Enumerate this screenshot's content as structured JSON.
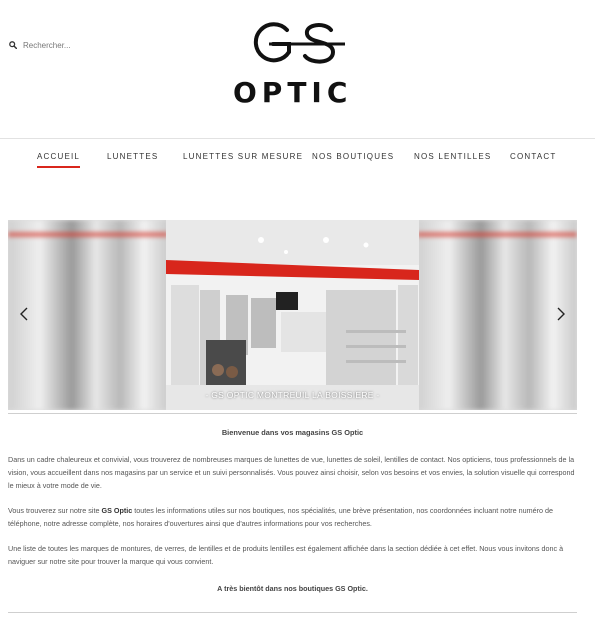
{
  "search": {
    "placeholder": "Rechercher..."
  },
  "logo": {
    "top": "GS",
    "bottom": "OPTIC"
  },
  "nav": {
    "items": [
      {
        "label": "ACCUEIL"
      },
      {
        "label": "LUNETTES"
      },
      {
        "label": "LUNETTES SUR MESURE"
      },
      {
        "label": "NOS BOUTIQUES"
      },
      {
        "label": "NOS LENTILLES"
      },
      {
        "label": "CONTACT"
      }
    ],
    "active_color": "#d9261c"
  },
  "slider": {
    "caption": "- GS OPTIC MONTREUIL LA BOISSIERE -",
    "prev_icon": "chevron-left-icon",
    "next_icon": "chevron-right-icon"
  },
  "content": {
    "heading": "Bienvenue dans vos magasins GS Optic",
    "p1": "Dans un cadre chaleureux et convivial, vous trouverez de nombreuses marques de lunettes de vue, lunettes de soleil, lentilles de contact. Nos opticiens, tous professionnels de la vision, vous accueillent dans nos magasins par un service et un suivi personnalisés. Vous pouvez ainsi choisir, selon vos besoins et vos envies, la solution visuelle qui correspond le mieux à votre mode de vie.",
    "p2_pre": "Vous trouverez sur notre site ",
    "p2_brand": "GS Optic",
    "p2_post": " toutes les informations utiles sur nos boutiques, nos spécialités, une brève présentation, nos coordonnées incluant notre numéro de téléphone, notre adresse complète, nos horaires d'ouvertures ainsi que d'autres informations pour vos recherches.",
    "p3": "Une liste de toutes les marques de montures, de verres, de lentilles et de produits lentilles est également affichée dans la section dédiée à cet effet. Nous vous invitons donc à naviguer sur notre site pour trouver la marque qui vous convient.",
    "closing": "A très bientôt dans nos boutiques GS Optic."
  }
}
